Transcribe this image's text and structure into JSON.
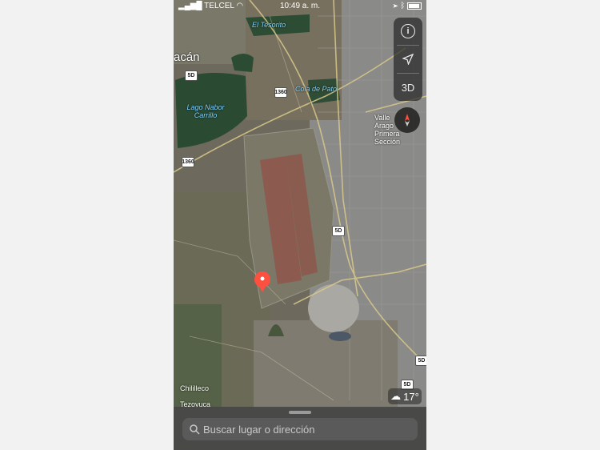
{
  "status_bar": {
    "carrier": "TELCEL",
    "time": "10:49 a. m."
  },
  "controls": {
    "info_label": "i",
    "threeD_label": "3D"
  },
  "map_labels": {
    "el_tesorito": "El Tesorito",
    "cola_de_pato": "Cola de Pato",
    "lago_line1": "Lago Nabor",
    "lago_line2": "Carrillo",
    "acan": "acán",
    "valle_line1": "Valle",
    "valle_line2": "Arago",
    "valle_line3": "Primera",
    "valle_line4": "Sección",
    "chililleco": "Chililleco",
    "tezoyuca": "Tezoyuca",
    "road_5d": "5D",
    "road_5d_b": "5D",
    "road_5d_c": "5D",
    "road_5d_d": "5D",
    "road_1360": "1360",
    "road_1360_b": "1360"
  },
  "weather": {
    "temperature": "17°"
  },
  "search": {
    "placeholder": "Buscar lugar o dirección"
  },
  "colors": {
    "water_accent": "#7fd3ff",
    "pin": "#ff4f3f"
  }
}
